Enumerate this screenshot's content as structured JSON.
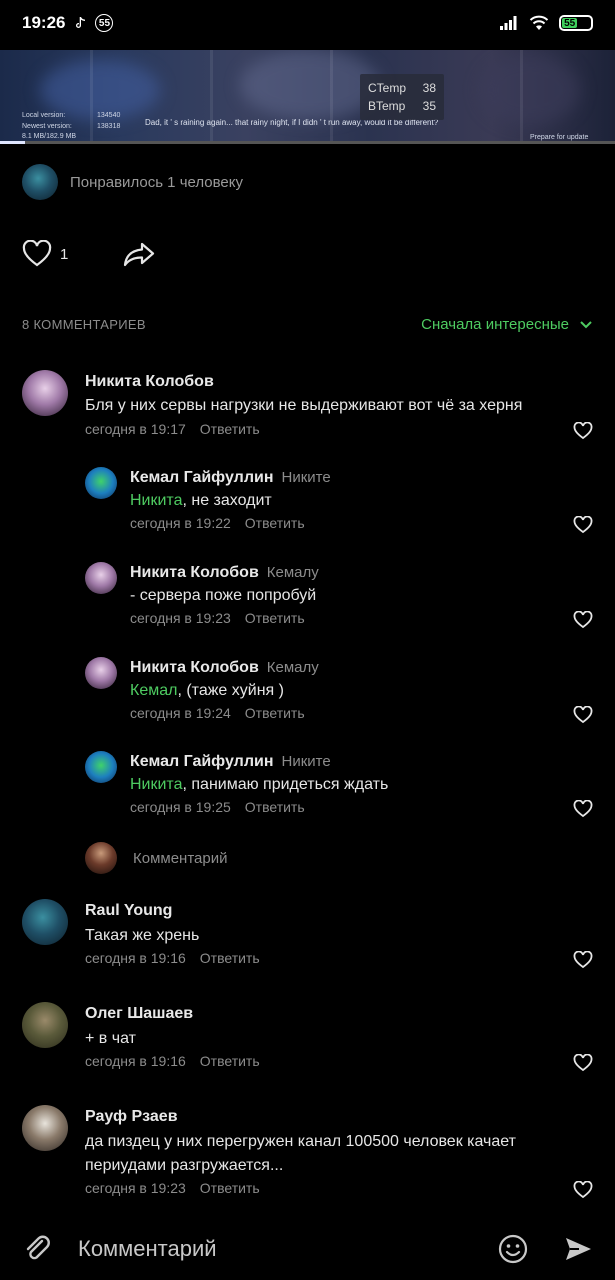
{
  "status_bar": {
    "time": "19:26",
    "notification_badge": "55",
    "battery_level": "55",
    "icons": [
      "tiktok-icon",
      "signal-icon",
      "wifi-icon",
      "battery-icon"
    ]
  },
  "banner": {
    "local_version_label": "Local version:",
    "local_version_value": "134540",
    "newest_version_label": "Newest version:",
    "newest_version_value": "138318",
    "download_size": "8.1 MB/182.9 MB",
    "quote": "Dad, it ' s raining again... that rainy night, if I didn ' t run away, would it be different?",
    "status": "Prepare for update",
    "ctemp_label": "CTemp",
    "ctemp_value": "38",
    "btemp_label": "BTemp",
    "btemp_value": "35",
    "progress": 0.04
  },
  "post": {
    "likes_text": "Понравилось 1 человеку",
    "like_count": "1"
  },
  "comments_header": {
    "count_label": "8 КОММЕНТАРИЕВ",
    "sort_label": "Сначала интересные"
  },
  "comments": [
    {
      "author": "Никита Колобов",
      "text": "Бля у них сервы нагрузки не выдерживают вот чё за херня",
      "time": "сегодня в 19:17",
      "reply": "Ответить"
    },
    {
      "author": "Кемал Гайфуллин",
      "reply_to": "Никите",
      "mention": "Никита",
      "text": ", не заходит",
      "time": "сегодня в 19:22",
      "reply": "Ответить"
    },
    {
      "author": "Никита Колобов",
      "reply_to": "Кемалу",
      "text": "- сервера поже попробуй",
      "time": "сегодня в 19:23",
      "reply": "Ответить"
    },
    {
      "author": "Никита Колобов",
      "reply_to": "Кемалу",
      "mention": "Кемал",
      "text": ", (таже хуйня )",
      "time": "сегодня в 19:24",
      "reply": "Ответить"
    },
    {
      "author": "Кемал Гайфуллин",
      "reply_to": "Никите",
      "mention": "Никита",
      "text": ", панимаю придеться ждать",
      "time": "сегодня в 19:25",
      "reply": "Ответить"
    },
    {
      "author": "Raul Young",
      "text": "Такая же хрень",
      "time": "сегодня в 19:16",
      "reply": "Ответить"
    },
    {
      "author": "Олег Шашаев",
      "text": "+ в чат",
      "time": "сегодня в 19:16",
      "reply": "Ответить"
    },
    {
      "author": "Рауф Рзаев",
      "text": "да пиздец у них перегружен канал 100500 человек качает",
      "text_line2": "периудами разгружается...",
      "time": "сегодня в 19:23",
      "reply": "Ответить"
    }
  ],
  "reply_input": {
    "placeholder": "Комментарий"
  },
  "composer": {
    "placeholder": "Комментарий"
  },
  "colors": {
    "background": "#000000",
    "accent_green": "#4ecb61",
    "secondary_text": "#8c8c8c"
  }
}
